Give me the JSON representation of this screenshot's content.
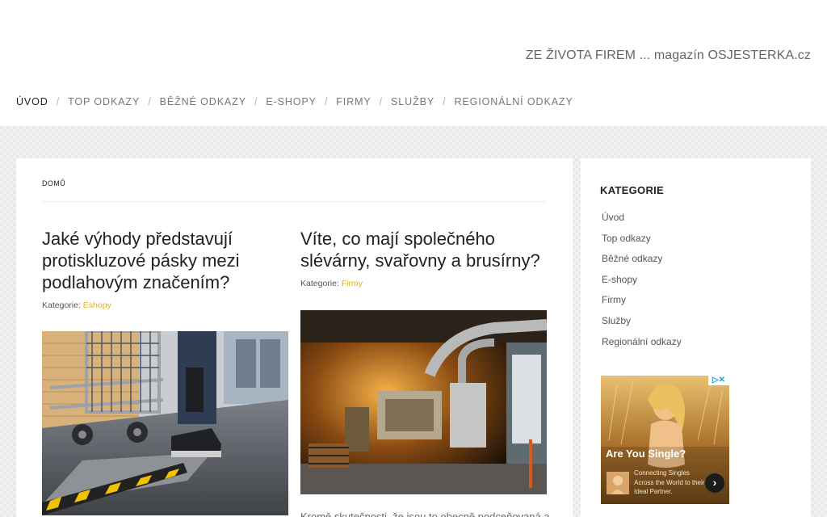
{
  "header": {
    "tagline": "ZE ŽIVOTA FIREM ... magazín OSJESTERKA.cz"
  },
  "nav": {
    "items": [
      "ÚVOD",
      "TOP ODKAZY",
      "BĚŽNÉ ODKAZY",
      "E-SHOPY",
      "FIRMY",
      "SLUŽBY",
      "REGIONÁLNÍ ODKAZY"
    ],
    "separator": "/"
  },
  "breadcrumb": "DOMŮ",
  "posts": [
    {
      "title": "Jaké výhody představují protiskluzové pásky mezi podlahovým značením?",
      "meta_label": "Kategorie:",
      "category": "Eshopy"
    },
    {
      "title": "Víte, co mají společného slévárny, svařovny a brusírny?",
      "meta_label": "Kategorie:",
      "category": "Firmy",
      "excerpt": "Kromě skutečnosti, že jsou to obecně podceňovaná a"
    }
  ],
  "sidebar": {
    "title": "KATEGORIE",
    "items": [
      "Úvod",
      "Top odkazy",
      "Běžné odkazy",
      "E-shopy",
      "Firmy",
      "Služby",
      "Regionální odkazy"
    ]
  },
  "ad": {
    "choices": "▷✕",
    "headline": "Are You Single?",
    "body": "Connecting Singles Across the World to their Ideal Partner.",
    "next_icon": "›"
  },
  "colors": {
    "accent": "#e5b21b",
    "text": "#222222",
    "muted": "#777777"
  }
}
